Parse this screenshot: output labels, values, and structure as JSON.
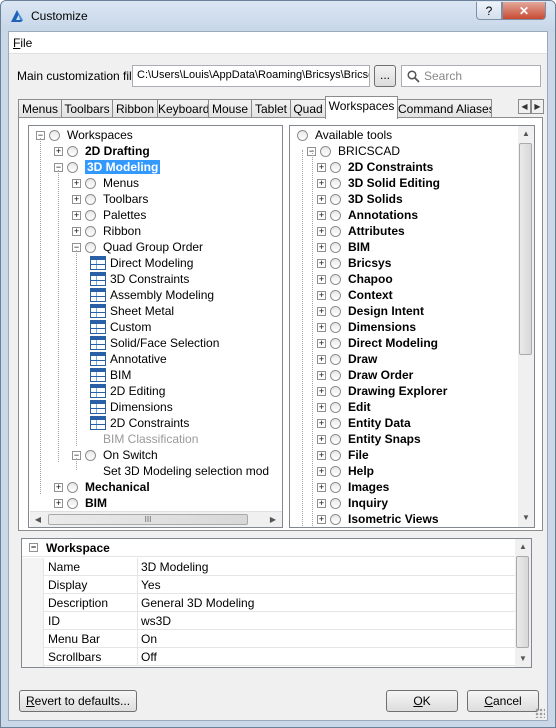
{
  "window": {
    "title": "Customize",
    "help_label": "?",
    "close_label": "✕"
  },
  "menu": {
    "file": "File"
  },
  "main_file": {
    "label": "Main customization file:",
    "path": "C:\\Users\\Louis\\AppData\\Roaming\\Bricsys\\Bricscad",
    "browse_label": "..."
  },
  "search": {
    "placeholder": "Search"
  },
  "tabs": [
    "Menus",
    "Toolbars",
    "Ribbon",
    "Keyboard",
    "Mouse",
    "Tablet",
    "Quad",
    "Workspaces",
    "Command Aliases"
  ],
  "active_tab": "Workspaces",
  "workspace_tree": [
    {
      "label": "Workspaces",
      "level": 0,
      "exp": "minus",
      "icon": "radio"
    },
    {
      "label": "2D Drafting",
      "level": 1,
      "exp": "plus",
      "icon": "radio",
      "bold": true
    },
    {
      "label": "3D Modeling",
      "level": 1,
      "exp": "minus",
      "icon": "radio",
      "bold": true,
      "selected": true
    },
    {
      "label": "Menus",
      "level": 2,
      "exp": "plus",
      "icon": "radio"
    },
    {
      "label": "Toolbars",
      "level": 2,
      "exp": "plus",
      "icon": "radio"
    },
    {
      "label": "Palettes",
      "level": 2,
      "exp": "plus",
      "icon": "radio"
    },
    {
      "label": "Ribbon",
      "level": 2,
      "exp": "plus",
      "icon": "radio"
    },
    {
      "label": "Quad Group Order",
      "level": 2,
      "exp": "minus",
      "icon": "radio"
    },
    {
      "label": "Direct Modeling",
      "level": 3,
      "icon": "tool"
    },
    {
      "label": "3D Constraints",
      "level": 3,
      "icon": "tool"
    },
    {
      "label": "Assembly Modeling",
      "level": 3,
      "icon": "tool"
    },
    {
      "label": "Sheet Metal",
      "level": 3,
      "icon": "tool"
    },
    {
      "label": "Custom",
      "level": 3,
      "icon": "tool"
    },
    {
      "label": "Solid/Face Selection",
      "level": 3,
      "icon": "tool"
    },
    {
      "label": "Annotative",
      "level": 3,
      "icon": "tool"
    },
    {
      "label": "BIM",
      "level": 3,
      "icon": "tool"
    },
    {
      "label": "2D Editing",
      "level": 3,
      "icon": "tool"
    },
    {
      "label": "Dimensions",
      "level": 3,
      "icon": "tool"
    },
    {
      "label": "2D Constraints",
      "level": 3,
      "icon": "tool"
    },
    {
      "label": "BIM Classification",
      "level": 3,
      "icon": "none",
      "gray": true
    },
    {
      "label": "On Switch",
      "level": 2,
      "exp": "minus",
      "icon": "radio"
    },
    {
      "label": "Set 3D Modeling selection mod",
      "level": 3,
      "icon": "none"
    },
    {
      "label": "Mechanical",
      "level": 1,
      "exp": "plus",
      "icon": "radio",
      "bold": true
    },
    {
      "label": "BIM",
      "level": 1,
      "exp": "plus",
      "icon": "radio",
      "bold": true
    }
  ],
  "tools_tree": [
    {
      "label": "Available tools",
      "level": 0,
      "icon": "radio"
    },
    {
      "label": "BRICSCAD",
      "level": 1,
      "exp": "minus",
      "icon": "radio"
    },
    {
      "label": "2D Constraints",
      "level": 2,
      "exp": "plus",
      "icon": "radio",
      "bold": true
    },
    {
      "label": "3D Solid Editing",
      "level": 2,
      "exp": "plus",
      "icon": "radio",
      "bold": true
    },
    {
      "label": "3D Solids",
      "level": 2,
      "exp": "plus",
      "icon": "radio",
      "bold": true
    },
    {
      "label": "Annotations",
      "level": 2,
      "exp": "plus",
      "icon": "radio",
      "bold": true
    },
    {
      "label": "Attributes",
      "level": 2,
      "exp": "plus",
      "icon": "radio",
      "bold": true
    },
    {
      "label": "BIM",
      "level": 2,
      "exp": "plus",
      "icon": "radio",
      "bold": true
    },
    {
      "label": "Bricsys",
      "level": 2,
      "exp": "plus",
      "icon": "radio",
      "bold": true
    },
    {
      "label": "Chapoo",
      "level": 2,
      "exp": "plus",
      "icon": "radio",
      "bold": true
    },
    {
      "label": "Context",
      "level": 2,
      "exp": "plus",
      "icon": "radio",
      "bold": true
    },
    {
      "label": "Design Intent",
      "level": 2,
      "exp": "plus",
      "icon": "radio",
      "bold": true
    },
    {
      "label": "Dimensions",
      "level": 2,
      "exp": "plus",
      "icon": "radio",
      "bold": true
    },
    {
      "label": "Direct Modeling",
      "level": 2,
      "exp": "plus",
      "icon": "radio",
      "bold": true
    },
    {
      "label": "Draw",
      "level": 2,
      "exp": "plus",
      "icon": "radio",
      "bold": true
    },
    {
      "label": "Draw Order",
      "level": 2,
      "exp": "plus",
      "icon": "radio",
      "bold": true
    },
    {
      "label": "Drawing Explorer",
      "level": 2,
      "exp": "plus",
      "icon": "radio",
      "bold": true
    },
    {
      "label": "Edit",
      "level": 2,
      "exp": "plus",
      "icon": "radio",
      "bold": true
    },
    {
      "label": "Entity Data",
      "level": 2,
      "exp": "plus",
      "icon": "radio",
      "bold": true
    },
    {
      "label": "Entity Snaps",
      "level": 2,
      "exp": "plus",
      "icon": "radio",
      "bold": true
    },
    {
      "label": "File",
      "level": 2,
      "exp": "plus",
      "icon": "radio",
      "bold": true
    },
    {
      "label": "Help",
      "level": 2,
      "exp": "plus",
      "icon": "radio",
      "bold": true
    },
    {
      "label": "Images",
      "level": 2,
      "exp": "plus",
      "icon": "radio",
      "bold": true
    },
    {
      "label": "Inquiry",
      "level": 2,
      "exp": "plus",
      "icon": "radio",
      "bold": true
    },
    {
      "label": "Isometric Views",
      "level": 2,
      "exp": "plus",
      "icon": "radio",
      "bold": true
    }
  ],
  "hscroll": {
    "thumb_label": "III"
  },
  "properties": {
    "section": "Workspace",
    "collapse_label": "−",
    "rows": [
      {
        "name": "Name",
        "value": "3D Modeling"
      },
      {
        "name": "Display",
        "value": "Yes"
      },
      {
        "name": "Description",
        "value": "General 3D Modeling"
      },
      {
        "name": "ID",
        "value": "ws3D"
      },
      {
        "name": "Menu Bar",
        "value": "On"
      },
      {
        "name": "Scrollbars",
        "value": "Off"
      }
    ]
  },
  "buttons": {
    "revert": "Revert to defaults...",
    "ok": "OK",
    "cancel": "Cancel"
  }
}
